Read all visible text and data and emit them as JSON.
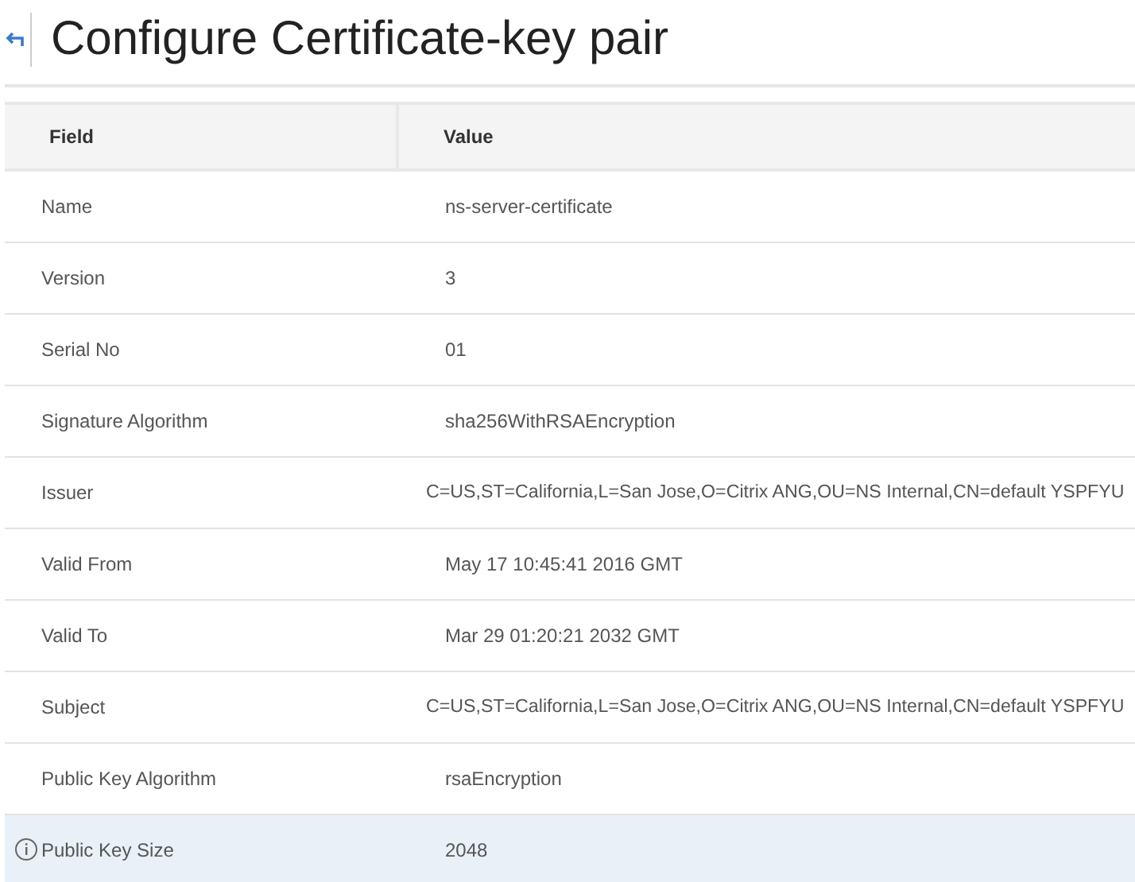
{
  "header": {
    "title": "Configure Certificate-key pair"
  },
  "table": {
    "columns": [
      "Field",
      "Value"
    ],
    "rows": [
      {
        "field": "Name",
        "value": "ns-server-certificate",
        "highlighted": false
      },
      {
        "field": "Version",
        "value": "3",
        "highlighted": false
      },
      {
        "field": "Serial No",
        "value": "01",
        "highlighted": false
      },
      {
        "field": "Signature Algorithm",
        "value": "sha256WithRSAEncryption",
        "highlighted": false
      },
      {
        "field": "Issuer",
        "value": "C=US,ST=California,L=San Jose,O=Citrix ANG,OU=NS Internal,CN=default YSPFYU",
        "highlighted": false
      },
      {
        "field": "Valid From",
        "value": "May 17 10:45:41 2016 GMT",
        "highlighted": false
      },
      {
        "field": "Valid To",
        "value": "Mar 29 01:20:21 2032 GMT",
        "highlighted": false
      },
      {
        "field": "Subject",
        "value": "C=US,ST=California,L=San Jose,O=Citrix ANG,OU=NS Internal,CN=default YSPFYU",
        "highlighted": false
      },
      {
        "field": "Public Key Algorithm",
        "value": "rsaEncryption",
        "highlighted": false
      },
      {
        "field": "Public Key Size",
        "value": "2048",
        "highlighted": true
      }
    ]
  }
}
